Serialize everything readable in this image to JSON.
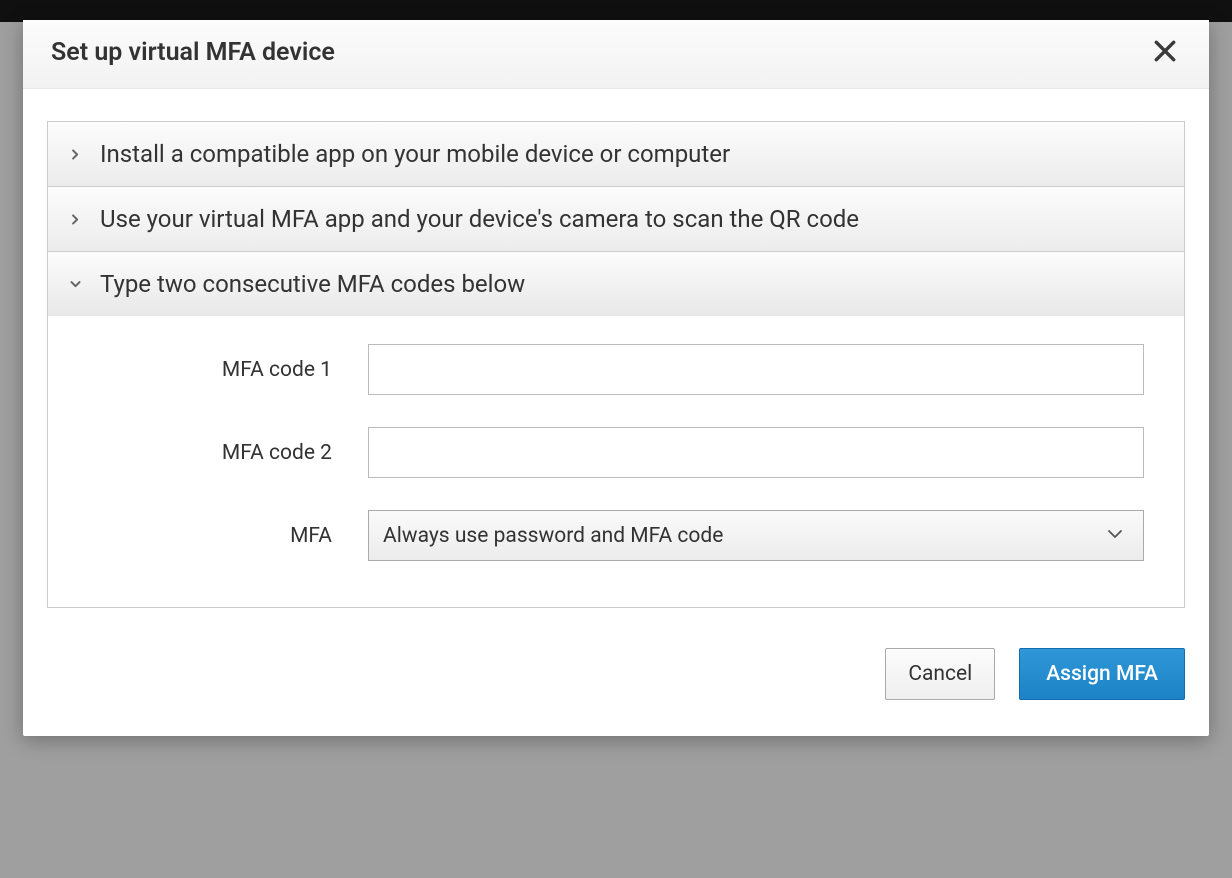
{
  "modal": {
    "title": "Set up virtual MFA device"
  },
  "accordion": {
    "step1": {
      "title": "Install a compatible app on your mobile device or computer"
    },
    "step2": {
      "title": "Use your virtual MFA app and your device's camera to scan the QR code"
    },
    "step3": {
      "title": "Type two consecutive MFA codes below"
    }
  },
  "form": {
    "code1": {
      "label": "MFA code 1",
      "value": ""
    },
    "code2": {
      "label": "MFA code 2",
      "value": ""
    },
    "mfa_select": {
      "label": "MFA",
      "selected": "Always use password and MFA code"
    }
  },
  "footer": {
    "cancel": "Cancel",
    "assign": "Assign MFA"
  }
}
